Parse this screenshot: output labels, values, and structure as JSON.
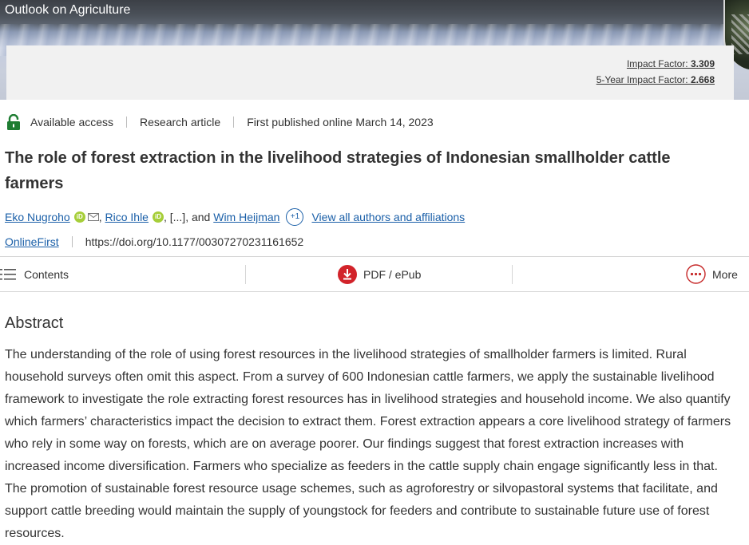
{
  "header": {
    "journal_title": "Outlook on Agriculture",
    "impact_factor_label": "Impact Factor: ",
    "impact_factor_value": "3.309",
    "five_year_label": "5-Year Impact Factor: ",
    "five_year_value": "2.668"
  },
  "meta": {
    "access": "Available access",
    "type": "Research article",
    "published": "First published online March 14, 2023"
  },
  "article": {
    "title": "The role of forest extraction in the livelihood strategies of Indonesian smallholder cattle farmers"
  },
  "authors": {
    "author1": "Eko Nugroho",
    "author2": "Rico Ihle",
    "ellipsis": ", [...], and ",
    "author3": "Wim Heijman",
    "more_count": "+1",
    "view_all": "View all authors and affiliations",
    "orcid_label": "iD"
  },
  "doi": {
    "status_link": "OnlineFirst",
    "doi": "https://doi.org/10.1177/00307270231161652"
  },
  "toolbar": {
    "contents": "Contents",
    "pdf": "PDF / ePub",
    "more": "More"
  },
  "abstract": {
    "heading": "Abstract",
    "text": "The understanding of the role of using forest resources in the livelihood strategies of smallholder farmers is limited. Rural household surveys often omit this aspect. From a survey of 600 Indonesian cattle farmers, we apply the sustainable livelihood framework to investigate the role extracting forest resources has in livelihood strategies and household income. We also quantify which farmers’ characteristics impact the decision to extract them. Forest extraction appears a core livelihood strategy of farmers who rely in some way on forests, which are on average poorer. Our findings suggest that forest extraction increases with increased income diversification. Farmers who specialize as feeders in the cattle supply chain engage significantly less in that. The promotion of sustainable forest resource usage schemes, such as agroforestry or silvopastoral systems that facilitate, and support cattle breeding would maintain the supply of youngstock for feeders and contribute to sustainable future use of forest resources."
  },
  "colors": {
    "link": "#1a5fa8",
    "lock": "#1e7d32",
    "pdf_red": "#d2232a",
    "more_red": "#c62828",
    "orcid": "#a6ce39"
  }
}
